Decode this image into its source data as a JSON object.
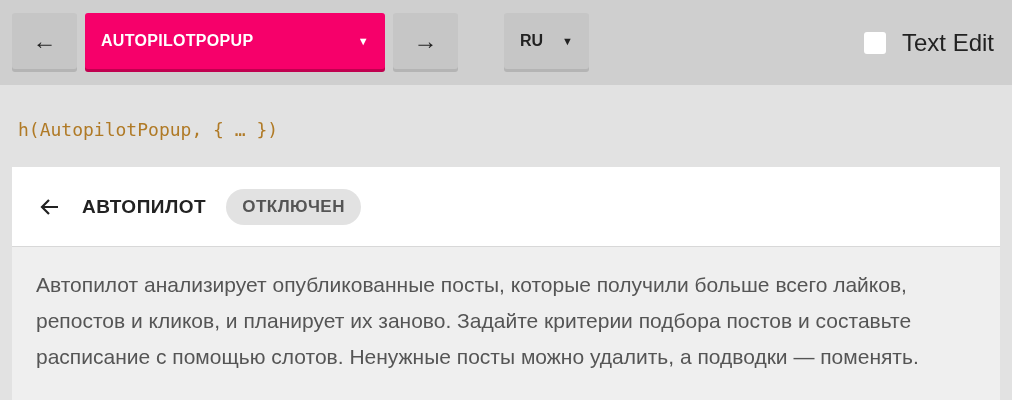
{
  "toolbar": {
    "prev_button": "←",
    "component_select": {
      "value": "AUTOPILOTPOPUP",
      "caret": "▼"
    },
    "next_button": "→",
    "language_select": {
      "value": "RU",
      "caret": "▼"
    },
    "text_edit": {
      "label": "Text Edit",
      "checked": false
    }
  },
  "code_line": "h(AutopilotPopup, { … })",
  "popup": {
    "title": "АВТОПИЛОТ",
    "status": "ОТКЛЮЧЕН",
    "description": "Автопилот анализирует опубликованные посты, которые получили больше всего лайков, репостов и кликов, и планирует их заново. Задайте критерии подбора постов и составьте расписание с помощью слотов. Ненужные посты можно удалить, а подводки — поменять."
  }
}
